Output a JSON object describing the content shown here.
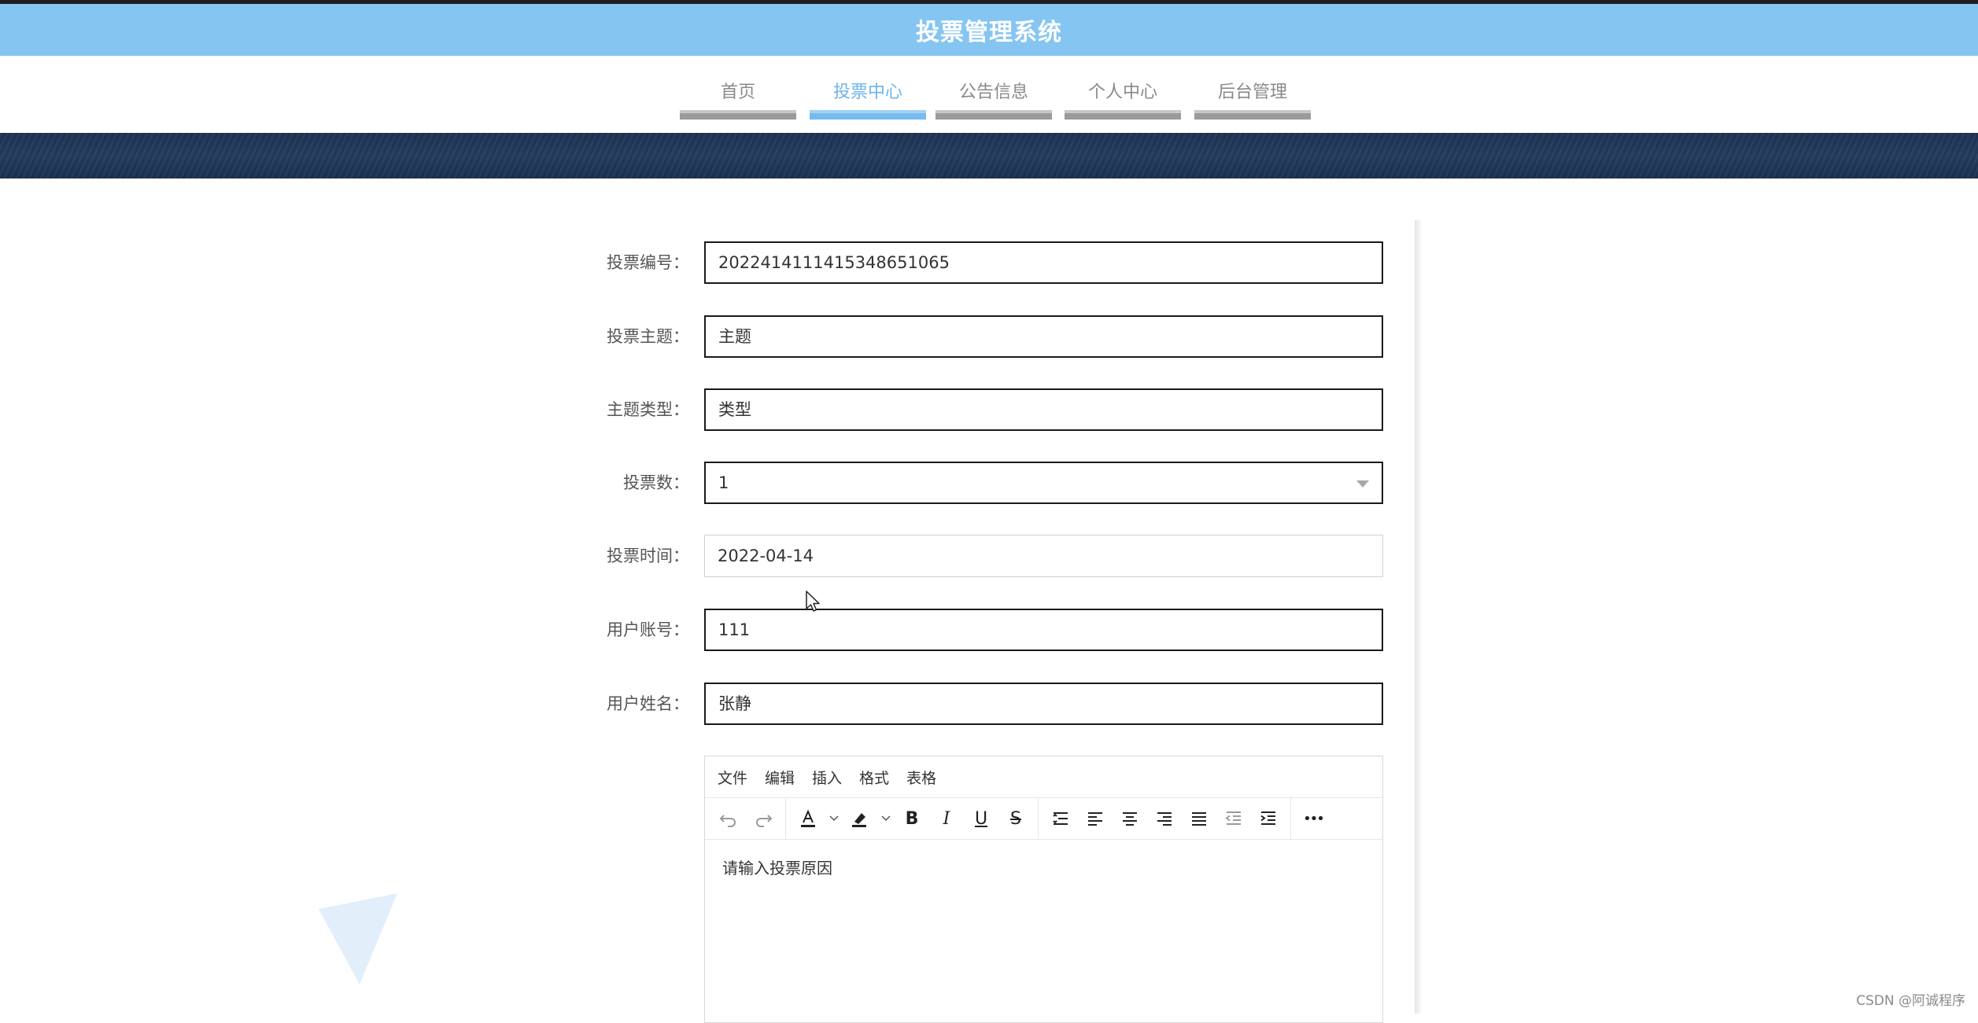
{
  "app": {
    "title": "投票管理系统"
  },
  "nav": {
    "items": [
      {
        "label": "首页",
        "active": false
      },
      {
        "label": "投票中心",
        "active": true
      },
      {
        "label": "公告信息",
        "active": false
      },
      {
        "label": "个人中心",
        "active": false
      },
      {
        "label": "后台管理",
        "active": false
      }
    ]
  },
  "form": {
    "vote_no": {
      "label": "投票编号：",
      "value": "2022414111415348651065"
    },
    "subject": {
      "label": "投票主题：",
      "value": "主题"
    },
    "subject_type": {
      "label": "主题类型：",
      "value": "类型"
    },
    "vote_count": {
      "label": "投票数：",
      "value": "1"
    },
    "vote_time": {
      "label": "投票时间：",
      "value": "2022-04-14"
    },
    "user_account": {
      "label": "用户账号：",
      "value": "111"
    },
    "user_name": {
      "label": "用户姓名：",
      "value": "张静"
    }
  },
  "editor": {
    "menu": [
      "文件",
      "编辑",
      "插入",
      "格式",
      "表格"
    ],
    "toolbar": {
      "bold": "B",
      "italic": "I",
      "underline": "U",
      "strikethrough": "S",
      "more": "•••"
    },
    "body_text": "请输入投票原因"
  },
  "watermark": "CSDN @阿诚程序",
  "colors": {
    "header_bg": "#85c5f2",
    "nav_active": "#6db4e8",
    "banner_bg": "#1e3352"
  }
}
